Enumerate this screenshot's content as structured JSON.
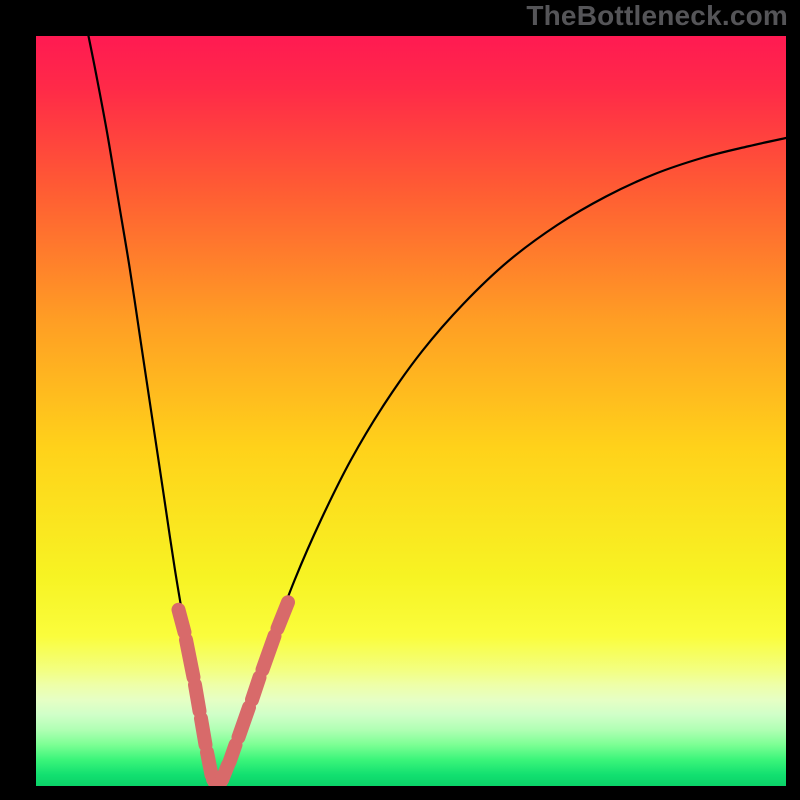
{
  "watermark": "TheBottleneck.com",
  "chart_data": {
    "type": "line",
    "title": "",
    "xlabel": "",
    "ylabel": "",
    "xlim": [
      0,
      100
    ],
    "ylim": [
      0,
      100
    ],
    "background_gradient": {
      "stops": [
        {
          "offset": 0.0,
          "color": "#ff1a52"
        },
        {
          "offset": 0.07,
          "color": "#ff2a48"
        },
        {
          "offset": 0.2,
          "color": "#ff5a34"
        },
        {
          "offset": 0.38,
          "color": "#ff9e24"
        },
        {
          "offset": 0.55,
          "color": "#ffd21a"
        },
        {
          "offset": 0.72,
          "color": "#f7f323"
        },
        {
          "offset": 0.8,
          "color": "#fafd3c"
        },
        {
          "offset": 0.845,
          "color": "#f3ff80"
        },
        {
          "offset": 0.865,
          "color": "#eeffa8"
        },
        {
          "offset": 0.885,
          "color": "#e6ffc4"
        },
        {
          "offset": 0.905,
          "color": "#d0ffc8"
        },
        {
          "offset": 0.925,
          "color": "#b0ffb4"
        },
        {
          "offset": 0.945,
          "color": "#7cff94"
        },
        {
          "offset": 0.965,
          "color": "#3bf57a"
        },
        {
          "offset": 0.985,
          "color": "#12e070"
        },
        {
          "offset": 1.0,
          "color": "#0bd268"
        }
      ]
    },
    "series": [
      {
        "name": "left_branch",
        "color": "#000000",
        "width": 2.2,
        "points": [
          {
            "x": 7.0,
            "y": 100.0
          },
          {
            "x": 8.0,
            "y": 95.0
          },
          {
            "x": 9.5,
            "y": 87.0
          },
          {
            "x": 11.0,
            "y": 78.0
          },
          {
            "x": 12.5,
            "y": 69.0
          },
          {
            "x": 14.0,
            "y": 59.0
          },
          {
            "x": 15.5,
            "y": 49.0
          },
          {
            "x": 17.0,
            "y": 39.0
          },
          {
            "x": 18.5,
            "y": 29.0
          },
          {
            "x": 20.0,
            "y": 20.0
          },
          {
            "x": 21.0,
            "y": 13.5
          },
          {
            "x": 22.0,
            "y": 8.0
          },
          {
            "x": 22.8,
            "y": 4.0
          },
          {
            "x": 23.4,
            "y": 1.8
          },
          {
            "x": 23.8,
            "y": 0.6
          },
          {
            "x": 24.3,
            "y": 0.0
          }
        ]
      },
      {
        "name": "right_branch",
        "color": "#000000",
        "width": 2.2,
        "points": [
          {
            "x": 24.3,
            "y": 0.0
          },
          {
            "x": 24.8,
            "y": 0.6
          },
          {
            "x": 25.6,
            "y": 2.2
          },
          {
            "x": 27.0,
            "y": 6.0
          },
          {
            "x": 29.0,
            "y": 12.0
          },
          {
            "x": 31.5,
            "y": 19.5
          },
          {
            "x": 34.5,
            "y": 27.5
          },
          {
            "x": 38.0,
            "y": 35.5
          },
          {
            "x": 42.0,
            "y": 43.5
          },
          {
            "x": 46.5,
            "y": 51.0
          },
          {
            "x": 51.5,
            "y": 58.0
          },
          {
            "x": 57.0,
            "y": 64.3
          },
          {
            "x": 63.0,
            "y": 70.0
          },
          {
            "x": 69.5,
            "y": 74.8
          },
          {
            "x": 76.0,
            "y": 78.6
          },
          {
            "x": 82.5,
            "y": 81.6
          },
          {
            "x": 89.0,
            "y": 83.8
          },
          {
            "x": 95.0,
            "y": 85.3
          },
          {
            "x": 100.0,
            "y": 86.4
          }
        ]
      }
    ],
    "markers": {
      "color": "#d86a6a",
      "shape": "rounded-segment",
      "items": [
        {
          "x1": 19.0,
          "y1": 23.5,
          "x2": 19.8,
          "y2": 20.5
        },
        {
          "x1": 20.0,
          "y1": 19.5,
          "x2": 21.0,
          "y2": 14.5
        },
        {
          "x1": 21.2,
          "y1": 13.5,
          "x2": 21.8,
          "y2": 10.0
        },
        {
          "x1": 22.0,
          "y1": 9.0,
          "x2": 22.6,
          "y2": 5.5
        },
        {
          "x1": 22.8,
          "y1": 4.5,
          "x2": 23.4,
          "y2": 1.5
        },
        {
          "x1": 23.6,
          "y1": 0.9,
          "x2": 24.0,
          "y2": 0.2
        },
        {
          "x1": 24.2,
          "y1": 0.1,
          "x2": 24.6,
          "y2": 0.5
        },
        {
          "x1": 24.8,
          "y1": 0.8,
          "x2": 25.6,
          "y2": 2.8
        },
        {
          "x1": 25.8,
          "y1": 3.2,
          "x2": 26.6,
          "y2": 5.5
        },
        {
          "x1": 27.0,
          "y1": 6.5,
          "x2": 28.4,
          "y2": 10.5
        },
        {
          "x1": 28.8,
          "y1": 11.5,
          "x2": 29.8,
          "y2": 14.5
        },
        {
          "x1": 30.2,
          "y1": 15.5,
          "x2": 31.8,
          "y2": 20.0
        },
        {
          "x1": 32.2,
          "y1": 21.0,
          "x2": 33.6,
          "y2": 24.5
        }
      ]
    }
  }
}
